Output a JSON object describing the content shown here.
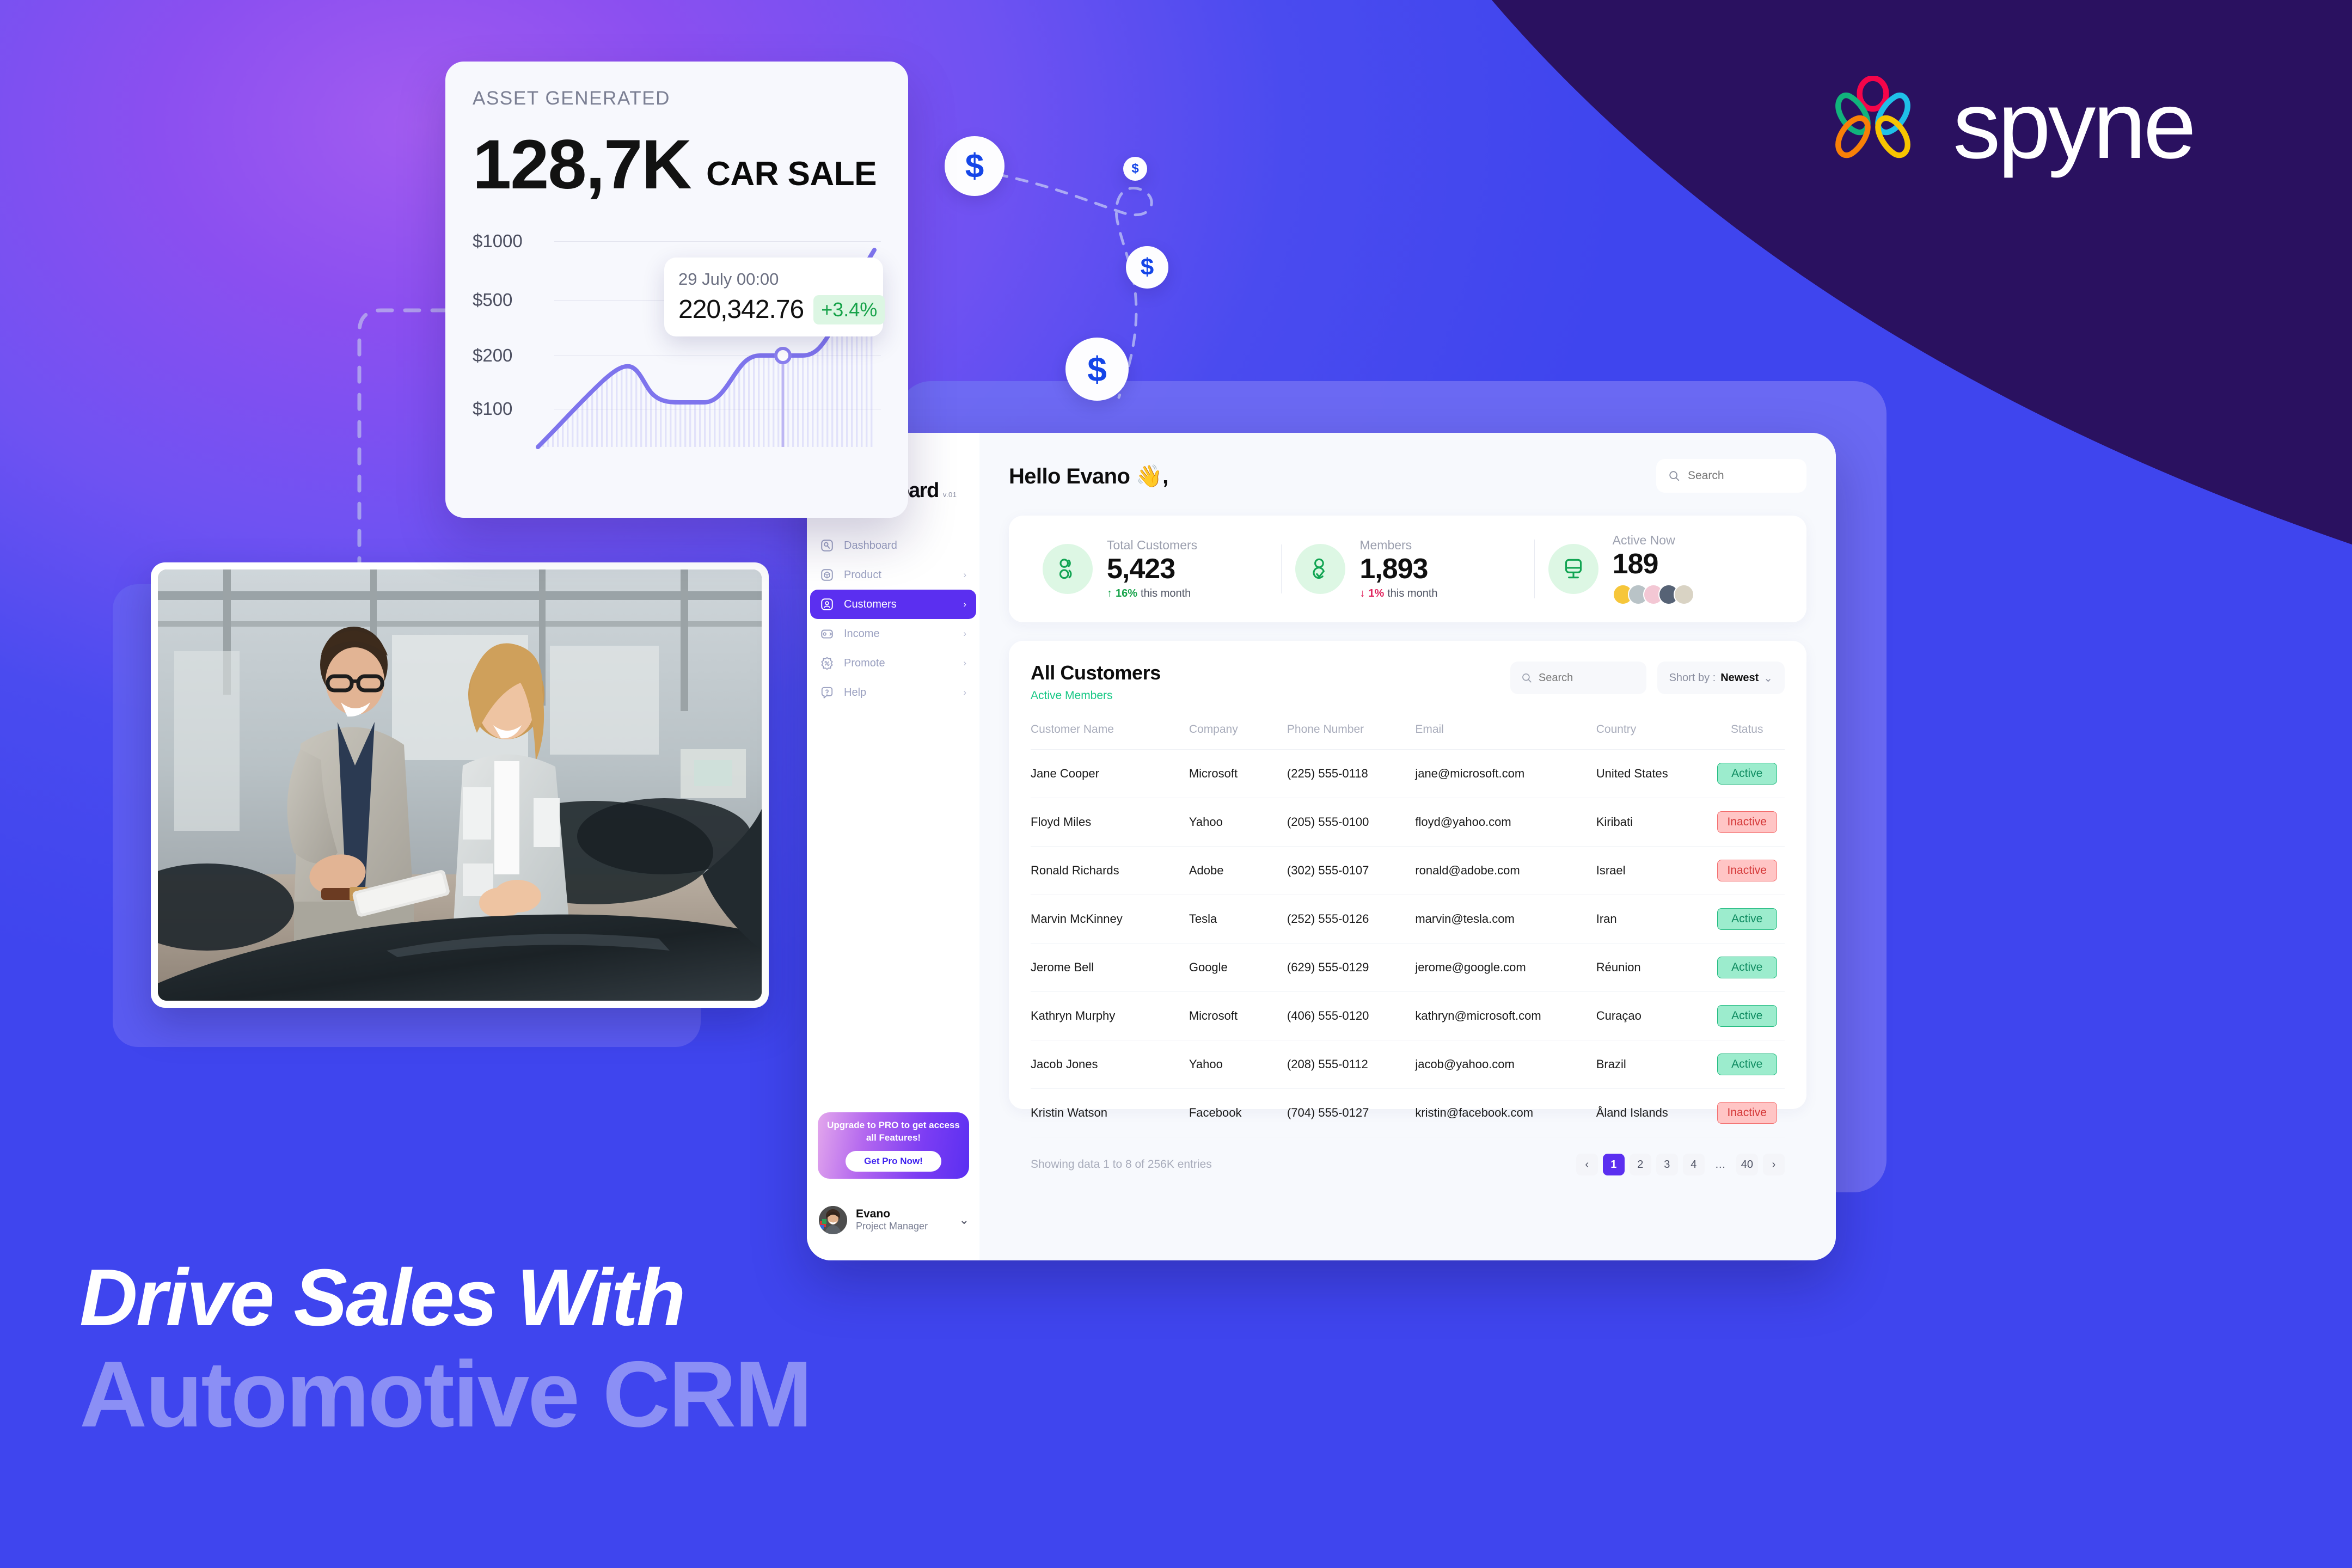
{
  "brand": {
    "logo_name": "spyne-logo",
    "wordmark": "spyne",
    "mark_colors": [
      "#f5054a",
      "#11b37c",
      "#1fc0e8",
      "#f98007",
      "#f7c400"
    ]
  },
  "headline": {
    "line1": "Drive Sales With",
    "line2": "Automotive CRM"
  },
  "chart_card": {
    "title": "ASSET GENERATED",
    "value": "128,7K",
    "badge": "CAR SALE",
    "tooltip": {
      "date": "29 July 00:00",
      "value": "220,342.76",
      "delta": "+3.4%"
    }
  },
  "chart_data": {
    "type": "area",
    "title": "ASSET GENERATED",
    "xlabel": "",
    "ylabel": "",
    "grid": true,
    "legend": "none",
    "ytick_labels": [
      "$1000",
      "$500",
      "$200",
      "$100"
    ],
    "ytick_values": [
      1000,
      500,
      200,
      100
    ],
    "ylim": [
      0,
      1200
    ],
    "x": [
      0,
      1,
      2,
      3,
      4,
      5,
      6,
      7,
      8,
      9,
      10,
      11,
      12
    ],
    "values": [
      20,
      48,
      75,
      108,
      118,
      92,
      86,
      86,
      88,
      125,
      168,
      172,
      172
    ],
    "highlight_point": {
      "x": 9.4,
      "label": "29 July 00:00",
      "value": "220,342.76",
      "delta": "+3.4%"
    },
    "series_color": "#7e74ed"
  },
  "money_bubbles": [
    {
      "name": "money-bubble-large-1",
      "label": "$"
    },
    {
      "name": "money-bubble-tiny",
      "label": "$"
    },
    {
      "name": "money-bubble-small",
      "label": "$"
    },
    {
      "name": "money-bubble-large-2",
      "label": "$"
    }
  ],
  "photo": {
    "alt": "car-dealership-salesman-and-customer"
  },
  "dashboard": {
    "sidebar": {
      "brand_title": "Dashboard",
      "brand_version": "v.01",
      "items": [
        {
          "label": "Dashboard",
          "icon": "dashboard-icon",
          "chevron": "",
          "active": false
        },
        {
          "label": "Product",
          "icon": "product-box-icon",
          "chevron": "›",
          "active": false
        },
        {
          "label": "Customers",
          "icon": "customers-person-icon",
          "chevron": "›",
          "active": true
        },
        {
          "label": "Income",
          "icon": "income-wallet-icon",
          "chevron": "›",
          "active": false
        },
        {
          "label": "Promote",
          "icon": "promote-discount-icon",
          "chevron": "›",
          "active": false
        },
        {
          "label": "Help",
          "icon": "help-question-icon",
          "chevron": "›",
          "active": false
        }
      ],
      "upgrade": {
        "text": "Upgrade to  PRO to get access all Features!",
        "button": "Get Pro Now!"
      },
      "user": {
        "name": "Evano",
        "role": "Project Manager",
        "chevron": "⌄"
      }
    },
    "topbar": {
      "greeting": "Hello Evano 👋,",
      "search_placeholder": "Search"
    },
    "stats": [
      {
        "label": "Total Customers",
        "value": "5,423",
        "trend_arrow": "↑",
        "trend_value": "16%",
        "trend_text": "this month",
        "direction": "up",
        "icon": "customers-group-icon"
      },
      {
        "label": "Members",
        "value": "1,893",
        "trend_arrow": "↓",
        "trend_value": "1%",
        "trend_text": "this month",
        "direction": "down",
        "icon": "member-check-icon"
      },
      {
        "label": "Active Now",
        "value": "189",
        "trend_arrow": "",
        "trend_value": "",
        "trend_text": "",
        "direction": "avatars",
        "icon": "monitor-icon"
      }
    ],
    "active_avatar_colors": [
      "#f6c63a",
      "#b9c3c7",
      "#f3c7d4",
      "#566275",
      "#d9d3c4"
    ],
    "table": {
      "title": "All Customers",
      "subtitle": "Active Members",
      "search_placeholder": "Search",
      "sort_label": "Short by :",
      "sort_value": "Newest",
      "sort_chevron": "⌄",
      "columns": [
        "Customer Name",
        "Company",
        "Phone Number",
        "Email",
        "Country",
        "Status"
      ],
      "rows": [
        {
          "name": "Jane Cooper",
          "company": "Microsoft",
          "phone": "(225) 555-0118",
          "email": "jane@microsoft.com",
          "country": "United States",
          "status": "Active"
        },
        {
          "name": "Floyd Miles",
          "company": "Yahoo",
          "phone": "(205) 555-0100",
          "email": "floyd@yahoo.com",
          "country": "Kiribati",
          "status": "Inactive"
        },
        {
          "name": "Ronald Richards",
          "company": "Adobe",
          "phone": "(302) 555-0107",
          "email": "ronald@adobe.com",
          "country": "Israel",
          "status": "Inactive"
        },
        {
          "name": "Marvin McKinney",
          "company": "Tesla",
          "phone": "(252) 555-0126",
          "email": "marvin@tesla.com",
          "country": "Iran",
          "status": "Active"
        },
        {
          "name": "Jerome Bell",
          "company": "Google",
          "phone": "(629) 555-0129",
          "email": "jerome@google.com",
          "country": "Réunion",
          "status": "Active"
        },
        {
          "name": "Kathryn Murphy",
          "company": "Microsoft",
          "phone": "(406) 555-0120",
          "email": "kathryn@microsoft.com",
          "country": "Curaçao",
          "status": "Active"
        },
        {
          "name": "Jacob Jones",
          "company": "Yahoo",
          "phone": "(208) 555-0112",
          "email": "jacob@yahoo.com",
          "country": "Brazil",
          "status": "Active"
        },
        {
          "name": "Kristin Watson",
          "company": "Facebook",
          "phone": "(704) 555-0127",
          "email": "kristin@facebook.com",
          "country": "Åland Islands",
          "status": "Inactive"
        }
      ],
      "footer_count": "Showing data 1 to 8 of  256K entries",
      "pagination": [
        "‹",
        "1",
        "2",
        "3",
        "4",
        "…",
        "40",
        "›"
      ],
      "pagination_selected": "1"
    }
  },
  "colors": {
    "accent_purple": "#5b2ff0",
    "bg_blue": "#3d47ee",
    "bg_dark": "#241055",
    "green": "#17a34a",
    "red": "#e0245e",
    "chart_line": "#7e74ed"
  }
}
